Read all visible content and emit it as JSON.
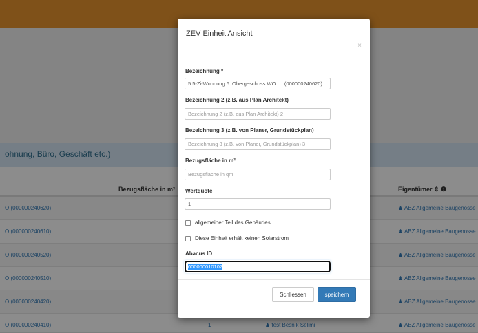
{
  "background": {
    "section_title": "ohnung, Büro, Geschäft etc.)",
    "columns": {
      "area": "Bezugsfläche in m² ⇕",
      "owner": "Eigentümer ⇕ ❶"
    },
    "rows": [
      {
        "name": "O (000000240620)",
        "num": "",
        "mid": "",
        "owner": "♟ ABZ Allgemeine Baugenosse"
      },
      {
        "name": "O (000000240610)",
        "num": "",
        "mid": "",
        "owner": "♟ ABZ Allgemeine Baugenosse"
      },
      {
        "name": "O (000000240520)",
        "num": "",
        "mid": "",
        "owner": "♟ ABZ Allgemeine Baugenosse"
      },
      {
        "name": "O (000000240510)",
        "num": "",
        "mid": "",
        "owner": "♟ ABZ Allgemeine Baugenosse"
      },
      {
        "name": "O (000000240420)",
        "num": "",
        "mid": "",
        "owner": "♟ ABZ Allgemeine Baugenosse"
      },
      {
        "name": "O (000000240410)",
        "num": "1",
        "mid": "♟ test Besnik Selimi",
        "owner": "♟ ABZ Allgemeine Baugenosse"
      }
    ]
  },
  "modal": {
    "title": "ZEV Einheit Ansicht",
    "close": "×",
    "fields": {
      "bezeichnung": {
        "label": "Bezeichnung *",
        "value": "5.5-Zi-Wohnung 6. Obergeschoss WO      (000000240620)"
      },
      "bezeichnung2": {
        "label": "Bezeichnung 2 (z.B. aus Plan Architekt)",
        "placeholder": "Bezeichnung 2 (z.B. aus Plan Architekt) 2"
      },
      "bezeichnung3": {
        "label": "Bezeichnung 3 (z.B. von Planer, Grundstückplan)",
        "placeholder": "Bezeichnung 3 (z.B. von Planer, Grundstückplan) 3"
      },
      "flaeche": {
        "label": "Bezugsfläche in m²",
        "placeholder": "Bezugsfläche in qm"
      },
      "wertquote": {
        "label": "Wertquote",
        "value": "1"
      },
      "abacus": {
        "label": "Abacus ID",
        "value": "000000010102"
      }
    },
    "checkboxes": {
      "allgemein": {
        "label": "allgemeiner Teil des Gebäudes",
        "checked": false
      },
      "solar": {
        "label": "Diese Einheit erhält keinen Solarstrom",
        "checked": false
      }
    },
    "buttons": {
      "close": "Schliessen",
      "save": "speichern"
    }
  },
  "colors": {
    "top_bar": "#e8942e",
    "primary": "#337ab7",
    "section_bg": "#d6e6f5"
  }
}
